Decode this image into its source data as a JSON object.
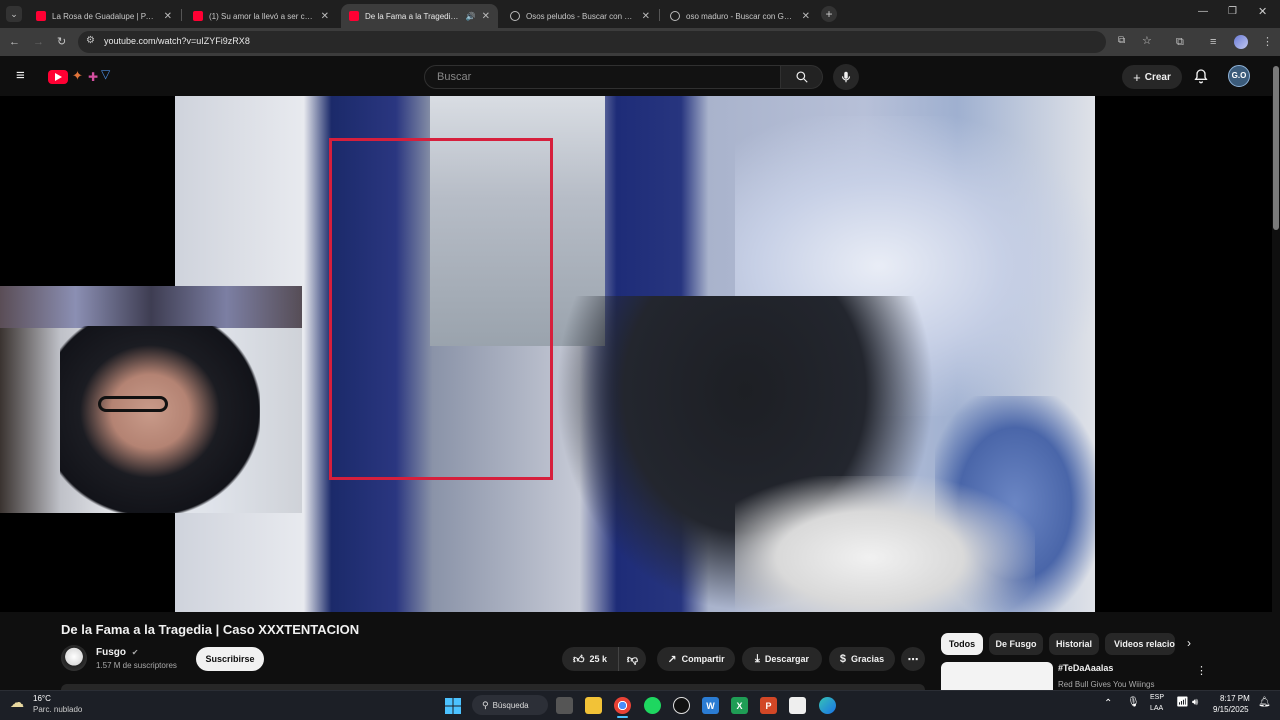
{
  "browser": {
    "tabs": [
      {
        "label": "La Rosa de Guadalupe | PARA",
        "favicon": "youtube-icon"
      },
      {
        "label": "(1) Su amor la llevó a ser crim",
        "favicon": "youtube-icon"
      },
      {
        "label": "De la Fama a la Tragedia | C",
        "favicon": "youtube-icon",
        "active": true
      },
      {
        "label": "Osos peludos - Buscar con Goo",
        "favicon": "google-icon"
      },
      {
        "label": "oso maduro - Buscar con Goog",
        "favicon": "google-icon"
      }
    ],
    "url": "youtube.com/watch?v=uIZYFi9zRX8"
  },
  "youtube": {
    "search_placeholder": "Buscar",
    "create_label": "Crear",
    "avatar_initials": "G.O"
  },
  "video": {
    "title": "De la Fama a la Tragedia | Caso XXXTENTACION",
    "channel": "Fusgo",
    "subscribers": "1.57 M de suscriptores",
    "subscribe_label": "Suscribirse",
    "likes": "25 k",
    "share_label": "Compartir",
    "download_label": "Descargar",
    "thanks_label": "Gracias"
  },
  "chips": [
    "Todos",
    "De Fusgo",
    "Historial",
    "Videos relacio"
  ],
  "recommended": {
    "title": "#TeDaAaalas",
    "subtitle": "Red Bull Gives You Wiiings"
  },
  "taskbar": {
    "weather_temp": "16°C",
    "weather_desc": "Parc. nublado",
    "search_label": "Búsqueda",
    "lang_top": "ESP",
    "lang_bottom": "LAA",
    "time": "8:17 PM",
    "date": "9/15/2025"
  },
  "colors": {
    "youtube_red": "#ff0033",
    "highlight_box": "#d61f3c",
    "background": "#0f0f0f"
  }
}
